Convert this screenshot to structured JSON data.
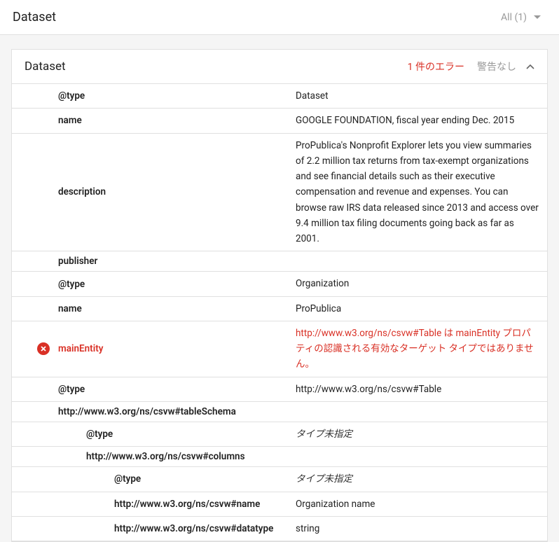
{
  "header": {
    "title": "Dataset",
    "filter": "All (1)"
  },
  "panel": {
    "title": "Dataset",
    "error_count": "1 件のエラー",
    "warning_count": "警告なし"
  },
  "rows": [
    {
      "key": "@type",
      "val": "Dataset",
      "level": 1
    },
    {
      "key": "name",
      "val": "GOOGLE FOUNDATION, fiscal year ending Dec. 2015",
      "level": 1
    },
    {
      "key": "description",
      "val": "ProPublica's Nonprofit Explorer lets you view summaries of 2.2 million tax returns from tax-exempt organizations and see financial details such as their executive compensation and revenue and expenses. You can browse raw IRS data released since 2013 and access over 9.4 million tax filing documents going back as far as 2001.",
      "level": 1
    },
    {
      "key": "publisher",
      "val": "",
      "level": 1
    },
    {
      "key": "@type",
      "val": "Organization",
      "level": 2
    },
    {
      "key": "name",
      "val": "ProPublica",
      "level": 2
    },
    {
      "key": "mainEntity",
      "val": "http://www.w3.org/ns/csvw#Table は mainEntity プロパティの認識される有効なターゲット タイプではありません。",
      "level": 1,
      "err": true
    },
    {
      "key": "@type",
      "val": "http://www.w3.org/ns/csvw#Table",
      "level": 2
    },
    {
      "key": "http://www.w3.org/ns/csvw#tableSchema",
      "val": "",
      "level": 2
    },
    {
      "key": "@type",
      "val": "タイプ未指定",
      "level": 4,
      "italic": true
    },
    {
      "key": "http://www.w3.org/ns/csvw#columns",
      "val": "",
      "level": 4
    },
    {
      "key": "@type",
      "val": "タイプ未指定",
      "level": 6,
      "italic": true
    },
    {
      "key": "http://www.w3.org/ns/csvw#name",
      "val": "Organization name",
      "level": 6
    },
    {
      "key": "http://www.w3.org/ns/csvw#datatype",
      "val": "string",
      "level": 6
    }
  ]
}
